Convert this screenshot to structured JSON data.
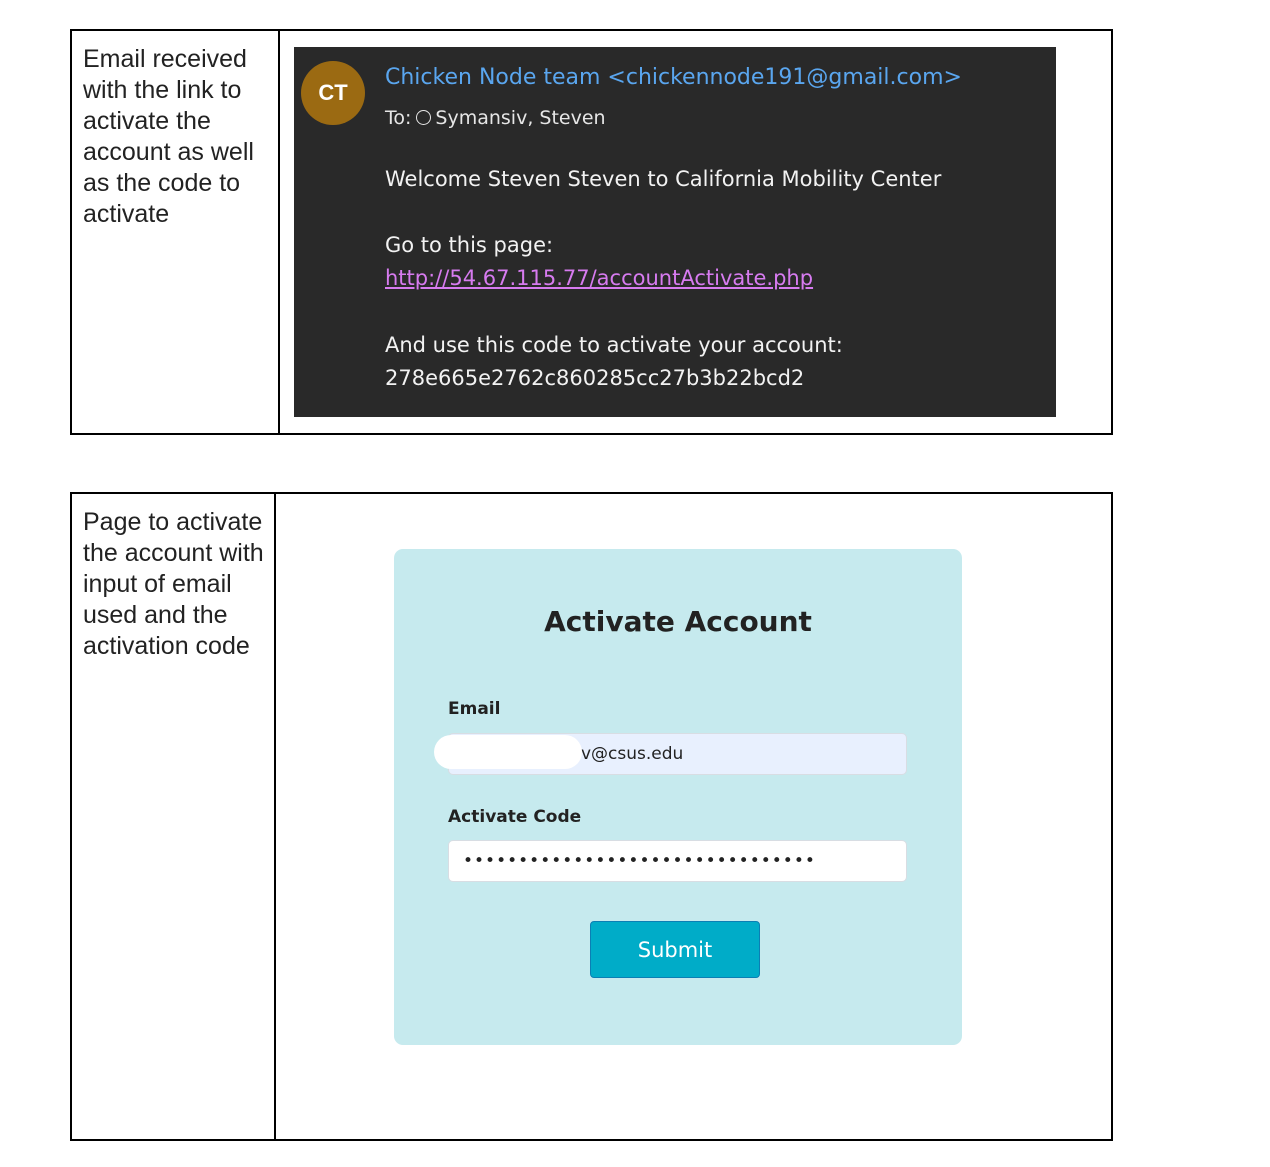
{
  "table1": {
    "description": "Email received with the link to activate the account as well as the code to activate",
    "email": {
      "avatar_initials": "CT",
      "avatar_color": "#9b6a12",
      "sender": "Chicken Node team <chickennode191@gmail.com>",
      "to_label": "To:",
      "to_icon": "radio-circle-icon",
      "recipient": "Symansiv, Steven",
      "welcome": "Welcome Steven Steven to California Mobility Center",
      "goto_text": "Go to this page:",
      "link": "http://54.67.115.77/accountActivate.php",
      "code_text": "And use this code to activate your account:",
      "code": "278e665e2762c860285cc27b3b22bcd2"
    }
  },
  "table2": {
    "description": "Page to activate the account with input of email used and the activation code",
    "form": {
      "title": "Activate Account",
      "email_label": "Email",
      "email_value": "v@csus.edu",
      "code_label": "Activate Code",
      "code_value": "••••••••••••••••••••••••••••••••",
      "submit_label": "Submit",
      "card_color": "#c6eaee",
      "button_color": "#00acc8"
    }
  }
}
